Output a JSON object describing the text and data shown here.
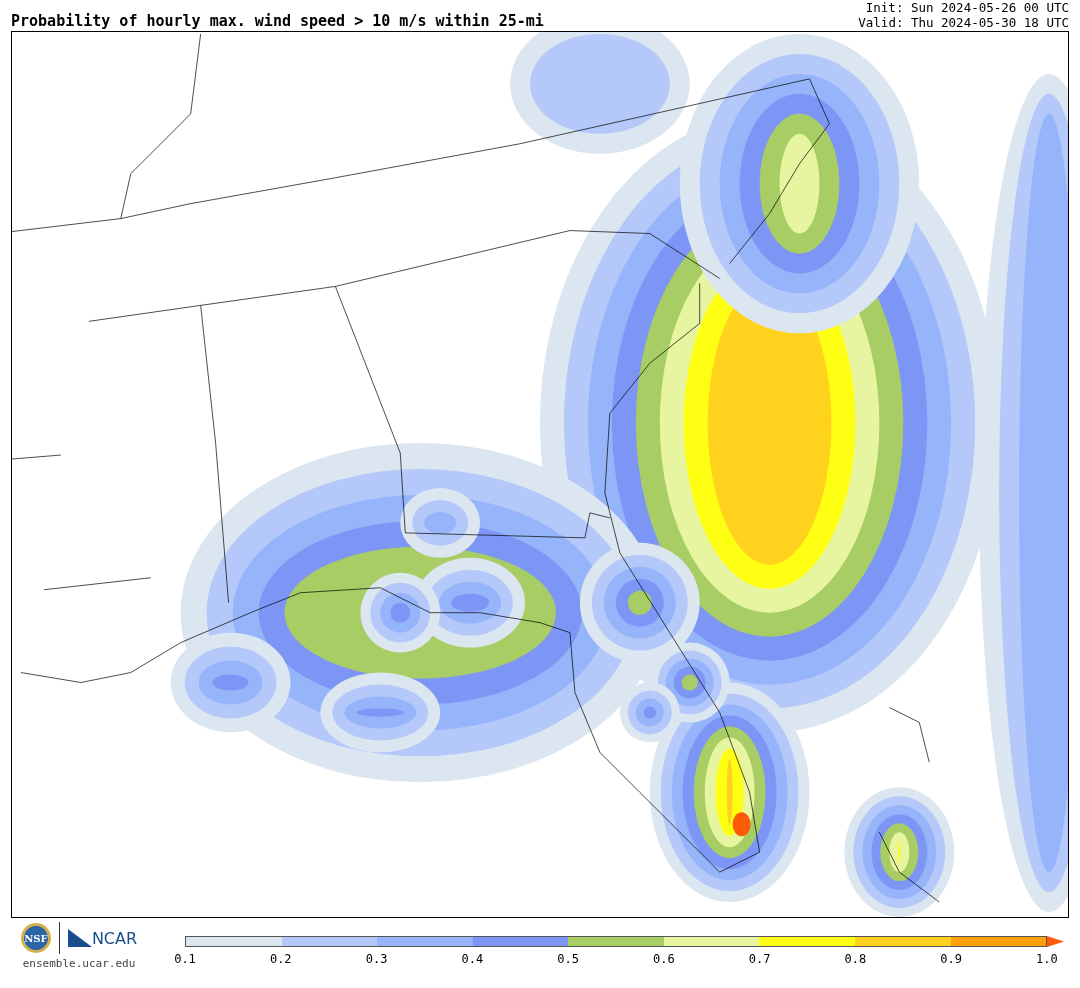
{
  "title": "Probability of hourly max. wind speed > 10 m/s within 25-mi",
  "init": "Init: Sun 2024-05-26 00 UTC",
  "valid": "Valid: Thu 2024-05-30 18 UTC",
  "logos": {
    "seal": "NSF",
    "org": "NCAR",
    "url": "ensemble.ucar.edu"
  },
  "colorbar": {
    "segments": [
      {
        "color": "#dce6f0"
      },
      {
        "color": "#b4c8fa"
      },
      {
        "color": "#96b4fa"
      },
      {
        "color": "#7d96f5"
      },
      {
        "color": "#a8cd64"
      },
      {
        "color": "#e8f5a0"
      },
      {
        "color": "#ffff14"
      },
      {
        "color": "#ffd21e"
      },
      {
        "color": "#ffa00a"
      }
    ],
    "arrow": {
      "color": "#ff5a0a"
    },
    "labels": [
      "0.1",
      "0.2",
      "0.3",
      "0.4",
      "0.5",
      "0.6",
      "0.7",
      "0.8",
      "0.9",
      "1.0"
    ]
  }
}
